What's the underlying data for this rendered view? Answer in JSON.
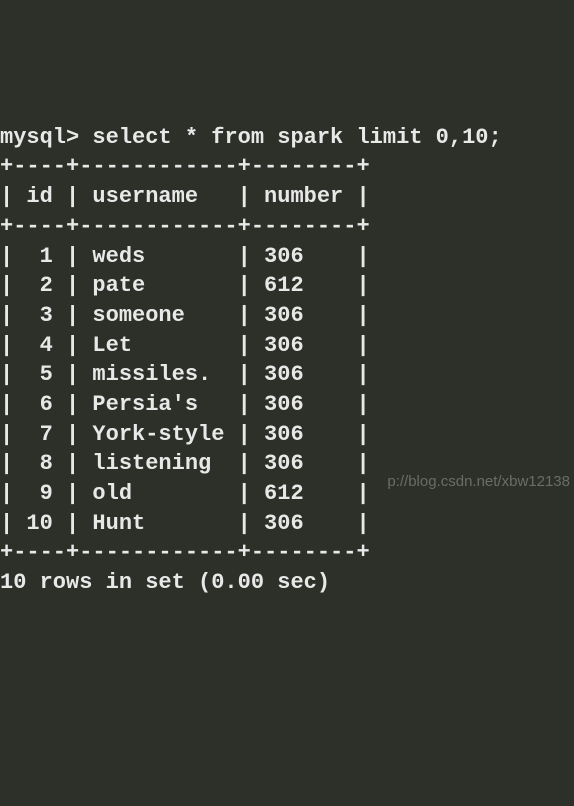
{
  "prompt": "mysql> ",
  "query": "select * from spark limit 0,10;",
  "table": {
    "border_top": "+----+------------+--------+",
    "border_mid": "+----+------------+--------+",
    "border_bot": "+----+------------+--------+",
    "header_line": "| id | username   | number |",
    "columns": [
      "id",
      "username",
      "number"
    ],
    "rows": [
      {
        "id": 1,
        "username": "weds",
        "number": 306
      },
      {
        "id": 2,
        "username": "pate",
        "number": 612
      },
      {
        "id": 3,
        "username": "someone",
        "number": 306
      },
      {
        "id": 4,
        "username": "Let",
        "number": 306
      },
      {
        "id": 5,
        "username": "missiles.",
        "number": 306
      },
      {
        "id": 6,
        "username": "Persia's",
        "number": 306
      },
      {
        "id": 7,
        "username": "York-style",
        "number": 306
      },
      {
        "id": 8,
        "username": "listening",
        "number": 306
      },
      {
        "id": 9,
        "username": "old",
        "number": 612
      },
      {
        "id": 10,
        "username": "Hunt",
        "number": 306
      }
    ]
  },
  "result_summary": "10 rows in set (0.00 sec)",
  "watermark": "p://blog.csdn.net/xbw12138",
  "chart_data": {
    "type": "table",
    "title": "MySQL query result: select * from spark limit 0,10",
    "columns": [
      "id",
      "username",
      "number"
    ],
    "rows": [
      [
        1,
        "weds",
        306
      ],
      [
        2,
        "pate",
        612
      ],
      [
        3,
        "someone",
        306
      ],
      [
        4,
        "Let",
        306
      ],
      [
        5,
        "missiles.",
        306
      ],
      [
        6,
        "Persia's",
        306
      ],
      [
        7,
        "York-style",
        306
      ],
      [
        8,
        "listening",
        306
      ],
      [
        9,
        "old",
        612
      ],
      [
        10,
        "Hunt",
        306
      ]
    ]
  }
}
